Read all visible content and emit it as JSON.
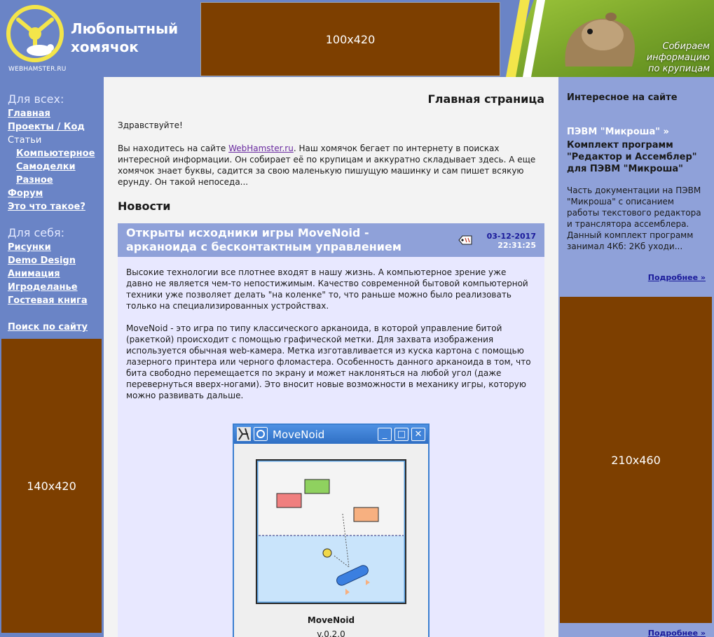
{
  "header": {
    "logo_url": "WEBHAMSTER.RU",
    "title_line1": "Любопытный",
    "title_line2": "хомячок",
    "banner": "100x420",
    "slogan_line1": "Собираем",
    "slogan_line2": "информацию",
    "slogan_line3": "по крупицам"
  },
  "left_nav": {
    "heading_all": "Для всех:",
    "items": [
      {
        "label": "Главная"
      },
      {
        "label": "Проекты / Код"
      },
      {
        "label": "Статьи"
      },
      {
        "label": "Компьютерное"
      },
      {
        "label": "Самоделки"
      },
      {
        "label": "Разное"
      },
      {
        "label": "Форум"
      },
      {
        "label": "Это что такое?"
      }
    ],
    "heading_self": "Для себя:",
    "self_items": [
      {
        "label": "Рисунки"
      },
      {
        "label": "Demo Design"
      },
      {
        "label": "Анимация"
      },
      {
        "label": "Игроделанье"
      },
      {
        "label": "Гостевая книга"
      }
    ],
    "search": "Поиск по сайту",
    "ad": "140x420"
  },
  "main": {
    "page_title": "Главная страница",
    "greeting": "Здравствуйте!",
    "intro_before": "Вы находитесь на сайте ",
    "intro_link": "WebHamster.ru",
    "intro_after": ". Наш хомячок бегает по интернету в поисках интересной информации. Он собирает её по крупицам и аккуратно складывает здесь. А еще хомячок знает буквы, садится за свою маленькую пишущую машинку и сам пишет всякую ерунду. Он такой непоседа...",
    "news_heading": "Новости",
    "news": {
      "title": "Открыты исходники игры MoveNoid - арканоида с бесконтактным управлением",
      "date": "03-12-2017",
      "time": "22:31:25",
      "para1": "Высокие технологии все плотнее входят в нашу жизнь. А компьютерное зрение уже давно не является чем-то непостижимым. Качество современной бытовой компьютерной техники уже позволяет делать \"на коленке\" то, что раньше можно было реализовать только на специализированных устройствах.",
      "para2": "MoveNoid - это игра по типу классического арканоида, в которой управление битой (ракеткой) происходит с помощью графической метки. Для захвата изображения используется обычная web-камера. Метка изготавливается из куска картона с помощью лазерного принтера или черного фломастера. Особенность данного арканоида в том, что бита свободно перемещается по экрану и может наклоняться на любой угол (даже перевернуться вверх-ногами). Это вносит новые возможности в механику игры, которую  можно развивать дальше."
    },
    "game_window": {
      "title": "MoveNoid",
      "app_name": "MoveNoid",
      "version": "v.0.2.0",
      "minimize": "_",
      "maximize": "□",
      "close": "✕"
    }
  },
  "right_sidebar": {
    "heading": "Интересное на сайте",
    "link": "ПЭВМ \"Микроша\" »",
    "title": "Комплект программ \"Редактор и Ассемблер\" для ПЭВМ \"Микроша\"",
    "text": "Часть документации на ПЭВМ \"Микроша\" с описанием работы текстового редактора и транслятора ассемблера. Данный комплект программ занимал 4Кб: 2Кб уходи...",
    "more": "Подробнее »",
    "ad": "210x460",
    "more2": "Подробнее »"
  },
  "colors": {
    "sidebar_blue": "#6a84c6",
    "right_blue": "#8fa1d9",
    "ad_brown": "#7d3f00",
    "news_bg": "#e8e8ff"
  }
}
